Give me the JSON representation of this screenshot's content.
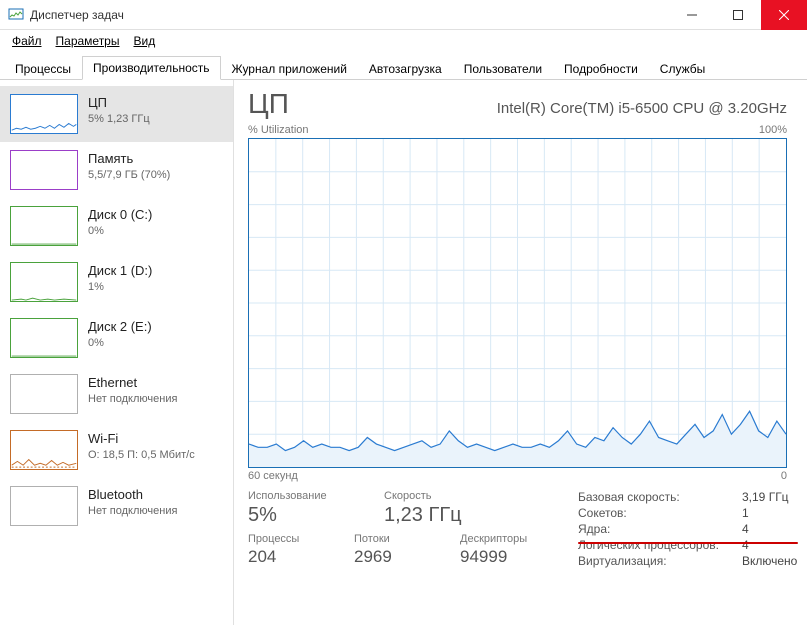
{
  "window": {
    "title": "Диспетчер задач"
  },
  "menu": {
    "file": "Файл",
    "options": "Параметры",
    "view": "Вид"
  },
  "tabs": {
    "processes": "Процессы",
    "performance": "Производительность",
    "app_history": "Журнал приложений",
    "startup": "Автозагрузка",
    "users": "Пользователи",
    "details": "Подробности",
    "services": "Службы"
  },
  "sidebar": [
    {
      "title": "ЦП",
      "sub": "5% 1,23 ГГц",
      "color": "#2a7bd1",
      "spark": "cpu",
      "selected": true
    },
    {
      "title": "Память",
      "sub": "5,5/7,9 ГБ (70%)",
      "color": "#9b3ec8",
      "spark": "none"
    },
    {
      "title": "Диск 0 (C:)",
      "sub": "0%",
      "color": "#4aa23c",
      "spark": "flat"
    },
    {
      "title": "Диск 1 (D:)",
      "sub": "1%",
      "color": "#4aa23c",
      "spark": "flat-jitter"
    },
    {
      "title": "Диск 2 (E:)",
      "sub": "0%",
      "color": "#4aa23c",
      "spark": "flat"
    },
    {
      "title": "Ethernet",
      "sub": "Нет подключения",
      "color": "#b0b0b0",
      "spark": "none"
    },
    {
      "title": "Wi-Fi",
      "sub": "О: 18,5 П: 0,5 Мбит/с",
      "color": "#c46b27",
      "spark": "wifi"
    },
    {
      "title": "Bluetooth",
      "sub": "Нет подключения",
      "color": "#b0b0b0",
      "spark": "none"
    }
  ],
  "main": {
    "title": "ЦП",
    "model": "Intel(R) Core(TM) i5-6500 CPU @ 3.20GHz",
    "axis_top_left": "% Utilization",
    "axis_top_right": "100%",
    "axis_bottom_left": "60 секунд",
    "axis_bottom_right": "0",
    "stats1": {
      "usage_label": "Использование",
      "usage_value": "5%",
      "speed_label": "Скорость",
      "speed_value": "1,23 ГГц"
    },
    "stats2": {
      "proc_label": "Процессы",
      "proc_value": "204",
      "threads_label": "Потоки",
      "threads_value": "2969",
      "handles_label": "Дескрипторы",
      "handles_value": "94999"
    },
    "details": {
      "base_speed_l": "Базовая скорость:",
      "base_speed_v": "3,19 ГГц",
      "sockets_l": "Сокетов:",
      "sockets_v": "1",
      "cores_l": "Ядра:",
      "cores_v": "4",
      "logical_l": "Логических процессоров:",
      "logical_v": "4",
      "virt_l": "Виртуализация:",
      "virt_v": "Включено"
    }
  },
  "chart_data": {
    "type": "line",
    "title": "% Utilization",
    "xlabel": "60 секунд",
    "ylabel": "% Utilization",
    "xlim": [
      0,
      60
    ],
    "ylim": [
      0,
      100
    ],
    "series": [
      {
        "name": "CPU",
        "values": [
          7,
          6,
          6,
          7,
          5,
          6,
          8,
          6,
          7,
          6,
          6,
          5,
          6,
          9,
          7,
          6,
          5,
          6,
          7,
          8,
          6,
          7,
          11,
          8,
          6,
          7,
          6,
          5,
          6,
          7,
          6,
          6,
          7,
          6,
          8,
          11,
          7,
          6,
          9,
          8,
          12,
          9,
          7,
          10,
          14,
          9,
          8,
          7,
          10,
          13,
          9,
          11,
          16,
          10,
          13,
          17,
          11,
          9,
          14,
          10
        ]
      }
    ]
  }
}
